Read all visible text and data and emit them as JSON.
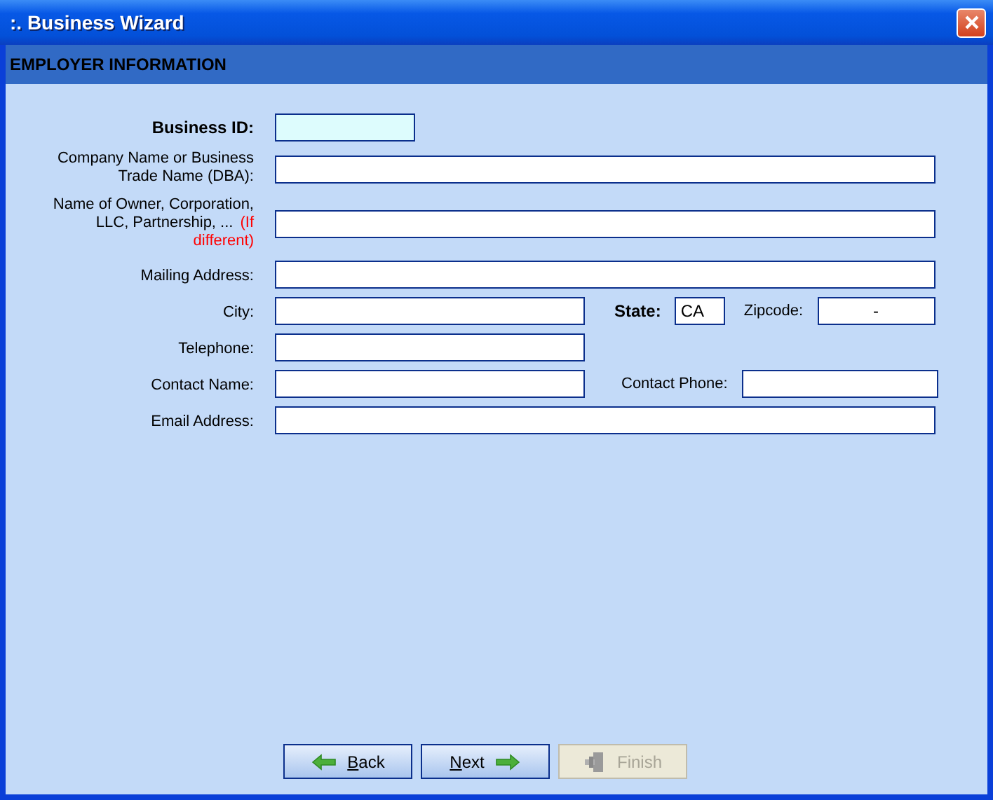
{
  "window": {
    "title": ":. Business Wizard"
  },
  "section": {
    "title": "EMPLOYER INFORMATION"
  },
  "rows": [
    {
      "fields": [
        {
          "kind": "id",
          "label": "Business ID:",
          "bold": true
        }
      ]
    },
    {
      "fields": [
        {
          "kind": "wide",
          "label": "Company Name or Business Trade Name (DBA):",
          "bold": false
        }
      ]
    },
    {
      "fields": [
        {
          "kind": "wide",
          "label": "Name of Owner, Corporation, LLC, Partnership, ...",
          "note": "(If different)",
          "bold": false
        }
      ]
    },
    {
      "fields": [
        {
          "kind": "wide",
          "label": "Mailing Address:",
          "bold": false
        }
      ]
    },
    {
      "fields": [
        {
          "kind": "half",
          "label": "City:",
          "bold": false
        },
        {
          "kind": "state",
          "label": "State:",
          "bold": true,
          "value": "CA"
        },
        {
          "kind": "zip",
          "label": "Zipcode:",
          "bold": false,
          "value": "-"
        }
      ]
    },
    {
      "fields": [
        {
          "kind": "half",
          "label": "Telephone:",
          "bold": false
        }
      ]
    },
    {
      "fields": [
        {
          "kind": "half",
          "label": "Contact Name:",
          "bold": false
        },
        {
          "kind": "phone",
          "label": "Contact Phone:",
          "bold": false
        }
      ]
    },
    {
      "fields": [
        {
          "kind": "wide",
          "label": "Email Address:",
          "bold": false
        }
      ]
    }
  ],
  "buttons": [
    {
      "kind": "back",
      "label": "Back",
      "disabled": false
    },
    {
      "kind": "next",
      "label": "Next",
      "disabled": false
    },
    {
      "kind": "finish",
      "label": "Finish",
      "disabled": true
    }
  ]
}
